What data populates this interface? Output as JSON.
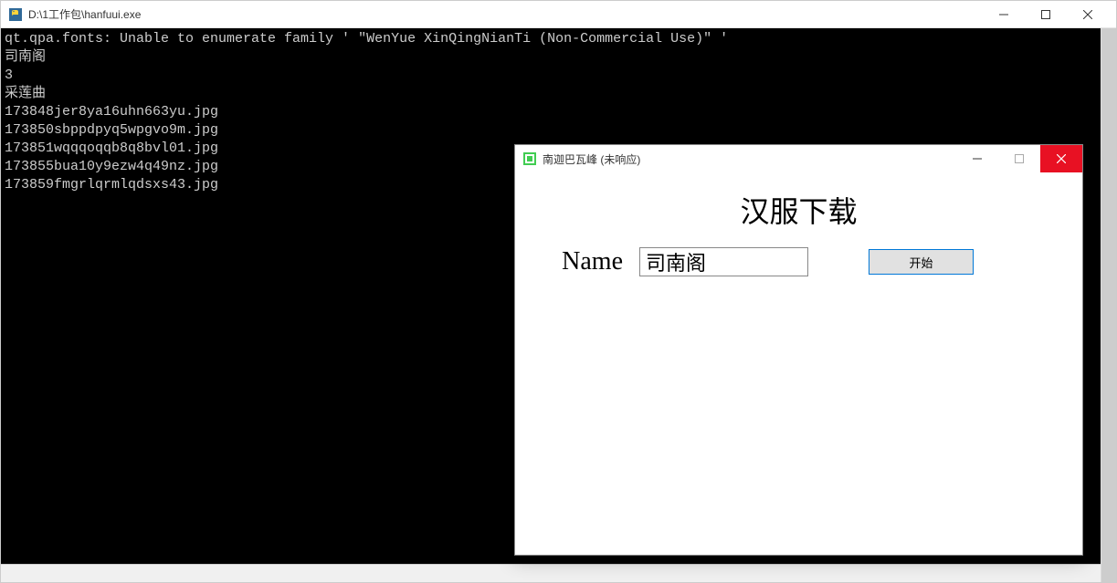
{
  "main_window": {
    "title": "D:\\1工作包\\hanfuui.exe",
    "console_lines": [
      "qt.qpa.fonts: Unable to enumerate family ' \"WenYue XinQingNianTi (Non-Commercial Use)\" '",
      "司南阁",
      "3",
      "采莲曲",
      "173848jer8ya16uhn663yu.jpg",
      "173850sbppdpyq5wpgvo9m.jpg",
      "173851wqqqoqqb8q8bvl01.jpg",
      "173855bua10y9ezw4q49nz.jpg",
      "173859fmgrlqrmlqdsxs43.jpg"
    ]
  },
  "dialog": {
    "title": "南迦巴瓦峰 (未响应)",
    "heading": "汉服下载",
    "name_label": "Name",
    "name_value": "司南阁",
    "start_button": "开始"
  },
  "icons": {
    "app_icon_name": "python-logo-icon",
    "dialog_icon_name": "qt-logo-icon"
  }
}
